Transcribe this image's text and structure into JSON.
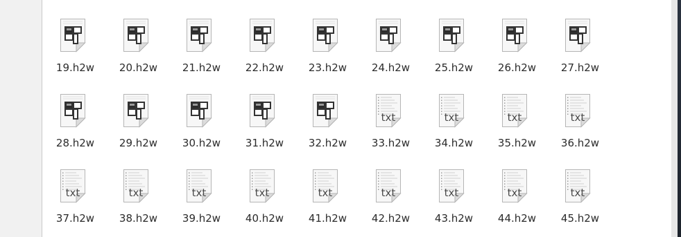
{
  "files": [
    {
      "name": "19.h2w",
      "icon": "tile-icon"
    },
    {
      "name": "20.h2w",
      "icon": "tile-icon"
    },
    {
      "name": "21.h2w",
      "icon": "tile-icon"
    },
    {
      "name": "22.h2w",
      "icon": "tile-icon"
    },
    {
      "name": "23.h2w",
      "icon": "tile-icon"
    },
    {
      "name": "24.h2w",
      "icon": "tile-icon"
    },
    {
      "name": "25.h2w",
      "icon": "tile-icon"
    },
    {
      "name": "26.h2w",
      "icon": "tile-icon"
    },
    {
      "name": "27.h2w",
      "icon": "tile-icon"
    },
    {
      "name": "28.h2w",
      "icon": "tile-icon"
    },
    {
      "name": "29.h2w",
      "icon": "tile-icon"
    },
    {
      "name": "30.h2w",
      "icon": "tile-icon"
    },
    {
      "name": "31.h2w",
      "icon": "tile-icon"
    },
    {
      "name": "32.h2w",
      "icon": "tile-icon"
    },
    {
      "name": "33.h2w",
      "icon": "txt-icon"
    },
    {
      "name": "34.h2w",
      "icon": "txt-icon"
    },
    {
      "name": "35.h2w",
      "icon": "txt-icon"
    },
    {
      "name": "36.h2w",
      "icon": "txt-icon"
    },
    {
      "name": "37.h2w",
      "icon": "txt-icon"
    },
    {
      "name": "38.h2w",
      "icon": "txt-icon"
    },
    {
      "name": "39.h2w",
      "icon": "txt-icon"
    },
    {
      "name": "40.h2w",
      "icon": "txt-icon"
    },
    {
      "name": "41.h2w",
      "icon": "txt-icon"
    },
    {
      "name": "42.h2w",
      "icon": "txt-icon"
    },
    {
      "name": "43.h2w",
      "icon": "txt-icon"
    },
    {
      "name": "44.h2w",
      "icon": "txt-icon"
    },
    {
      "name": "45.h2w",
      "icon": "txt-icon"
    }
  ],
  "icon_text": {
    "txt": "txt"
  },
  "colors": {
    "page": "#ffffff",
    "sidebar": "#f1f1f1",
    "label": "#2b2b2b",
    "edge": "#2b3340"
  }
}
